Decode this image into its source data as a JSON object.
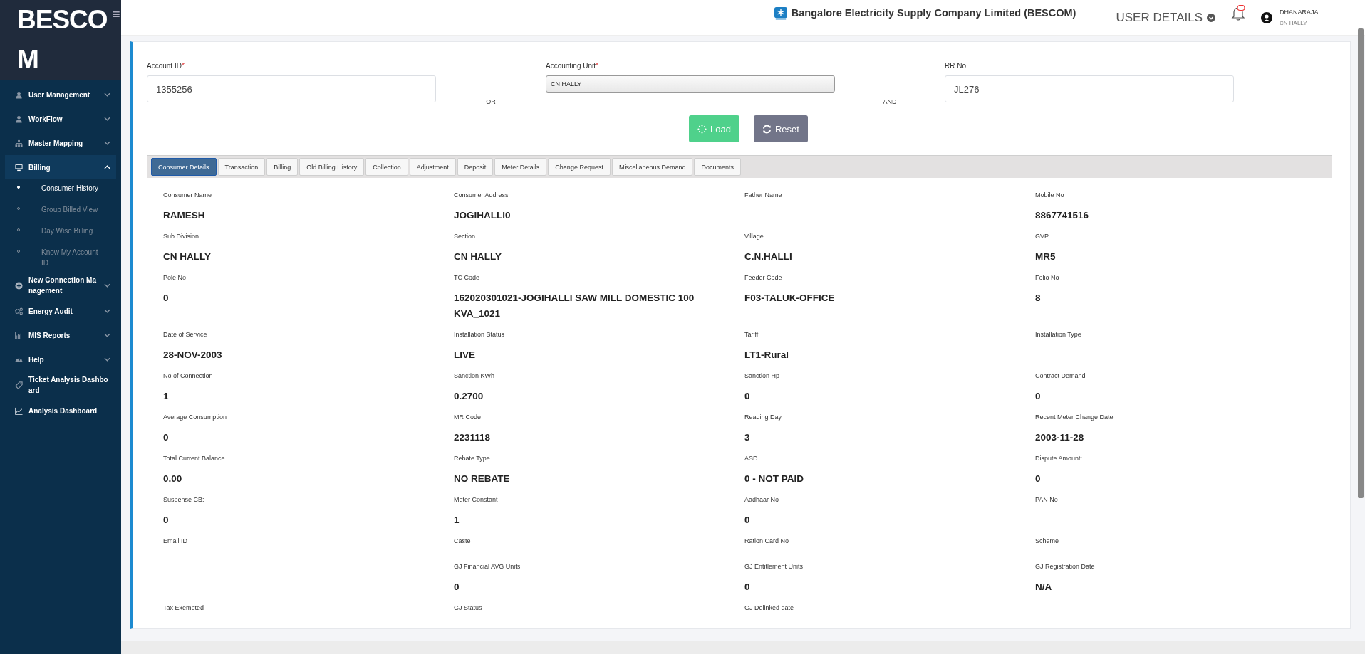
{
  "sidebar": {
    "logo": "BESCOM",
    "menu_glyph": "≡",
    "items": [
      {
        "label": "User Management",
        "expanded": false
      },
      {
        "label": "WorkFlow",
        "expanded": false
      },
      {
        "label": "Master Mapping",
        "expanded": false
      },
      {
        "label": "Billing",
        "expanded": true,
        "children": [
          {
            "label": "Consumer History",
            "selected": true
          },
          {
            "label": "Group Billed View",
            "selected": false
          },
          {
            "label": "Day Wise Billing",
            "selected": false
          },
          {
            "label": "Know My Account ID",
            "selected": false
          }
        ]
      },
      {
        "label": "New Connection Management",
        "expanded": false
      },
      {
        "label": "Energy Audit",
        "expanded": false
      },
      {
        "label": "MIS Reports",
        "expanded": false
      },
      {
        "label": "Help",
        "expanded": false
      },
      {
        "label": "Ticket Analysis Dashboard"
      },
      {
        "label": "Analysis Dashboard"
      }
    ]
  },
  "header": {
    "company": "Bangalore Electricity Supply Company Limited (BESCOM)",
    "user_menu": "USER DETAILS",
    "user_name": "DHANARAJA",
    "user_unit": "CN HALLY"
  },
  "form": {
    "required_mark": "*",
    "fields": [
      {
        "kind": "text",
        "label": "Account ID",
        "required": true,
        "value": "1355256"
      },
      {
        "kind": "connector",
        "label": "OR"
      },
      {
        "kind": "select",
        "label": "Accounting Unit",
        "required": true,
        "value": "CN HALLY"
      },
      {
        "kind": "connector",
        "label": "AND"
      },
      {
        "kind": "text",
        "label": "RR No",
        "required": false,
        "value": "JL276"
      }
    ],
    "buttons": [
      {
        "label": "Load",
        "kind": "load"
      },
      {
        "label": "Reset",
        "kind": "reset"
      }
    ]
  },
  "tabs": [
    {
      "label": "Consumer Details",
      "selected": true
    },
    {
      "label": "Transaction",
      "selected": false
    },
    {
      "label": "Billing",
      "selected": false
    },
    {
      "label": "Old Billing History",
      "selected": false
    },
    {
      "label": "Collection",
      "selected": false
    },
    {
      "label": "Adjustment",
      "selected": false
    },
    {
      "label": "Deposit",
      "selected": false
    },
    {
      "label": "Meter Details",
      "selected": false
    },
    {
      "label": "Change Request",
      "selected": false
    },
    {
      "label": "Miscellaneous Demand",
      "selected": false
    },
    {
      "label": "Documents",
      "selected": false
    }
  ],
  "details": [
    [
      {
        "label": "Consumer Name",
        "value": "RAMESH"
      },
      {
        "label": "Consumer Address",
        "value": "JOGIHALLI0"
      },
      {
        "label": "Father Name"
      },
      {
        "label": "Mobile No",
        "value": "8867741516"
      }
    ],
    [
      {
        "label": "Sub Division",
        "value": "CN HALLY"
      },
      {
        "label": "Section",
        "value": "CN HALLY"
      },
      {
        "label": "Village",
        "value": "C.N.HALLI"
      },
      {
        "label": "GVP",
        "value": "MR5"
      }
    ],
    [
      {
        "label": "Pole No",
        "value": "0"
      },
      {
        "label": "TC Code",
        "value": "162020301021-JOGIHALLI SAW MILL DOMESTIC 100 KVA_1021"
      },
      {
        "label": "Feeder Code",
        "value": "F03-TALUK-OFFICE"
      },
      {
        "label": "Folio No",
        "value": "8"
      }
    ],
    [
      {
        "label": "Date of Service",
        "value": "28-NOV-2003"
      },
      {
        "label": "Installation Status",
        "value": "LIVE"
      },
      {
        "label": "Tariff",
        "value": "LT1-Rural"
      },
      {
        "label": "Installation Type"
      }
    ],
    [
      {
        "label": "No of Connection",
        "value": "1"
      },
      {
        "label": "Sanction KWh",
        "value": "0.2700"
      },
      {
        "label": "Sanction Hp",
        "value": "0"
      },
      {
        "label": "Contract Demand",
        "value": "0"
      }
    ],
    [
      {
        "label": "Average Consumption",
        "value": "0"
      },
      {
        "label": "MR Code",
        "value": "2231118"
      },
      {
        "label": "Reading Day",
        "value": "3"
      },
      {
        "label": "Recent Meter Change Date",
        "value": "2003-11-28"
      }
    ],
    [
      {
        "label": "Total Current Balance",
        "value": "0.00"
      },
      {
        "label": "Rebate Type",
        "value": "NO REBATE"
      },
      {
        "label": "ASD",
        "value": "0 - NOT PAID"
      },
      {
        "label": "Dispute Amount:",
        "value": "0"
      }
    ],
    [
      {
        "label": "Suspense CB:",
        "value": "0"
      },
      {
        "label": "Meter Constant",
        "value": "1"
      },
      {
        "label": "Aadhaar No",
        "value": "0"
      },
      {
        "label": "PAN No"
      }
    ],
    [
      {
        "label": "Email ID"
      },
      {
        "label": "Caste"
      },
      {
        "label": "Ration Card No"
      },
      {
        "label": "Scheme"
      }
    ],
    [
      {
        "label": "GJ Financial AVG Units",
        "value": "0"
      },
      {
        "label": "GJ Entitlement Units",
        "value": "0"
      },
      {
        "label": "GJ Registration Date",
        "value": "N/A"
      }
    ],
    [
      {
        "label": "Tax Exempted"
      },
      {
        "label": "GJ Status"
      },
      {
        "label": "GJ Delinked date"
      }
    ]
  ]
}
